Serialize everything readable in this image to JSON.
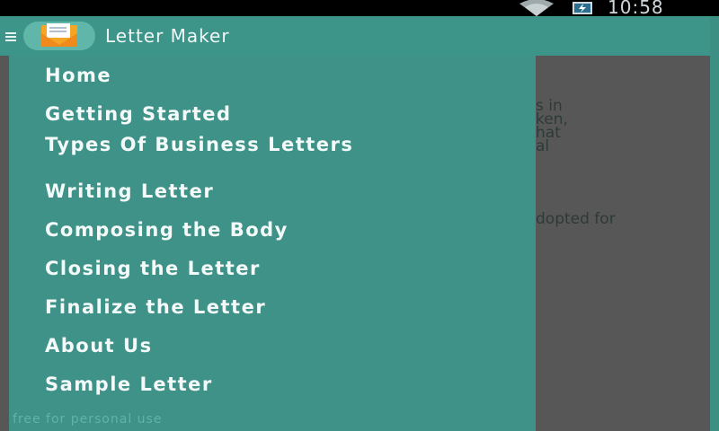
{
  "status_bar": {
    "time": "10:58",
    "icons": [
      "wifi-icon",
      "battery-icon"
    ]
  },
  "app_bar": {
    "title": "Letter Maker",
    "menu_icon": "hamburger-icon",
    "logo_icon": "envelope-icon"
  },
  "drawer": {
    "items": [
      {
        "label": "Home"
      },
      {
        "label": "Getting Started"
      },
      {
        "label": "Types Of Business Letters"
      },
      {
        "label": "Writing Letter"
      },
      {
        "label": "Composing the Body"
      },
      {
        "label": "Closing the Letter"
      },
      {
        "label": "Finalize the Letter"
      },
      {
        "label": "About Us"
      },
      {
        "label": "Sample Letter"
      }
    ],
    "footer": "free for personal use"
  },
  "background_content": {
    "lines": [
      "s in",
      "ken,",
      "hat",
      "al",
      "dopted for"
    ]
  },
  "colors": {
    "app_bar": "#3d9488",
    "drawer": "#3e9287",
    "dim_overlay": "#575757",
    "status_bar": "#000000"
  }
}
